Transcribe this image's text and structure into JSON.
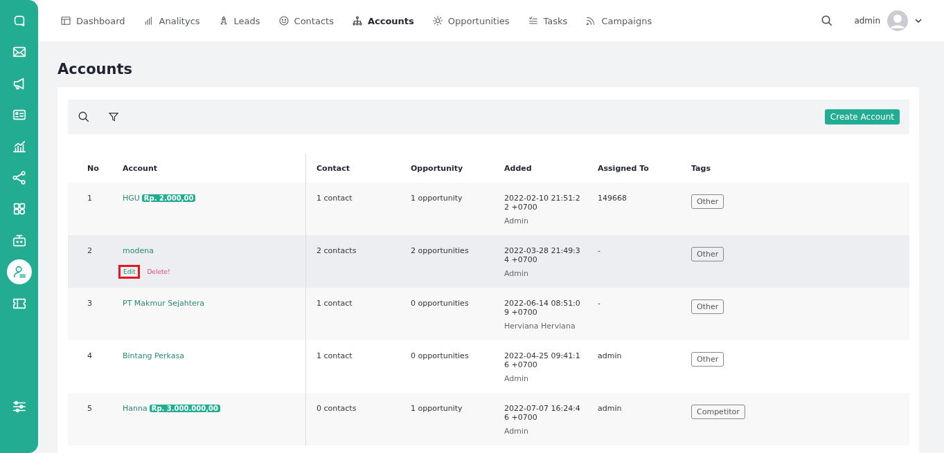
{
  "sidebar": {
    "items": [
      {
        "selected": false
      },
      {
        "selected": false
      },
      {
        "selected": false
      },
      {
        "selected": false
      },
      {
        "selected": false
      },
      {
        "selected": false
      },
      {
        "selected": false
      },
      {
        "selected": false
      },
      {
        "selected": true
      },
      {
        "selected": false
      }
    ]
  },
  "nav": {
    "items": [
      {
        "label": "Dashboard",
        "selected": false
      },
      {
        "label": "Analitycs",
        "selected": false
      },
      {
        "label": "Leads",
        "selected": false
      },
      {
        "label": "Contacts",
        "selected": false
      },
      {
        "label": "Accounts",
        "selected": true
      },
      {
        "label": "Opportunities",
        "selected": false
      },
      {
        "label": "Tasks",
        "selected": false
      },
      {
        "label": "Campaigns",
        "selected": false
      }
    ],
    "user": "admin"
  },
  "page_title": "Accounts",
  "toolbar": {
    "create_button": "Create Account"
  },
  "table": {
    "columns": [
      "No",
      "Account",
      "Contact",
      "Opportunity",
      "Added",
      "Assigned To",
      "Tags"
    ],
    "rows": [
      {
        "no": "1",
        "account": "HGU",
        "amount": "Rp. 2.000,00",
        "contact": "1 contact",
        "opportunity": "1 opportunity",
        "added": "2022-02-10 21:51:22 +0700",
        "added_by": "Admin",
        "assigned": "149668",
        "tag": "Other",
        "hovered": false
      },
      {
        "no": "2",
        "account": "modena",
        "actions": [
          {
            "label": "Edit",
            "kind": "edit",
            "highlighted": true
          },
          {
            "label": "Delete!",
            "kind": "delete",
            "highlighted": false
          }
        ],
        "contact": "2 contacts",
        "opportunity": "2 opportunities",
        "added": "2022-03-28 21:49:34 +0700",
        "added_by": "Admin",
        "assigned": "-",
        "tag": "Other",
        "hovered": true
      },
      {
        "no": "3",
        "account": "PT Makmur Sejahtera",
        "contact": "1 contact",
        "opportunity": "0 opportunities",
        "added": "2022-06-14 08:51:09 +0700",
        "added_by": "Herviana Herviana",
        "assigned": "-",
        "tag": "Other",
        "hovered": false
      },
      {
        "no": "4",
        "account": "Bintang Perkasa",
        "contact": "1 contact",
        "opportunity": "0 opportunities",
        "added": "2022-04-25 09:41:16 +0700",
        "added_by": "Admin",
        "assigned": "admin",
        "tag": "Other",
        "hovered": false
      },
      {
        "no": "5",
        "account": "Hanna",
        "amount": "Rp. 3.000.000,00",
        "contact": "0 contacts",
        "opportunity": "1 opportunity",
        "added": "2022-07-07 16:24:46 +0700",
        "added_by": "Admin",
        "assigned": "admin",
        "tag": "Competitor",
        "hovered": false
      }
    ]
  }
}
